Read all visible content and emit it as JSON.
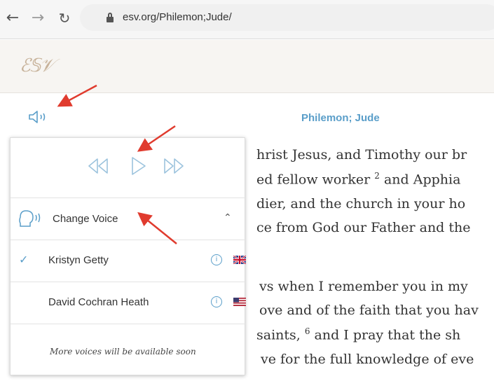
{
  "browser": {
    "back": "←",
    "forward": "→",
    "reload": "C",
    "url": "esv.org/Philemon;Jude/"
  },
  "site": {
    "logo": "ESV"
  },
  "audio": {
    "chapter_title": "Philemon; Jude"
  },
  "panel": {
    "change_voice_label": "Change Voice",
    "voices": [
      {
        "name": "Kristyn Getty",
        "selected": true,
        "flag": "uk-flag-icon"
      },
      {
        "name": "David Cochran Heath",
        "selected": false,
        "flag": "us-flag-icon"
      }
    ],
    "more_voices": "More voices will be available soon"
  },
  "scripture": {
    "line1": "hrist Jesus, and Timothy our br",
    "line2a": "ed fellow worker ",
    "v2": "2",
    "line2b": " and Apphia",
    "line3": "dier, and the church in your ho",
    "line4": "ce from God our Father and the",
    "line5": "vs when I remember you in my",
    "line6": "ove and of the faith that you hav",
    "line7a": " saints, ",
    "v6": "6",
    "line7b": " and I pray that the sh",
    "line8": "ve for the full knowledge of eve"
  },
  "colors": {
    "accent": "#5a9ec9",
    "arrow": "#e03b2e"
  }
}
